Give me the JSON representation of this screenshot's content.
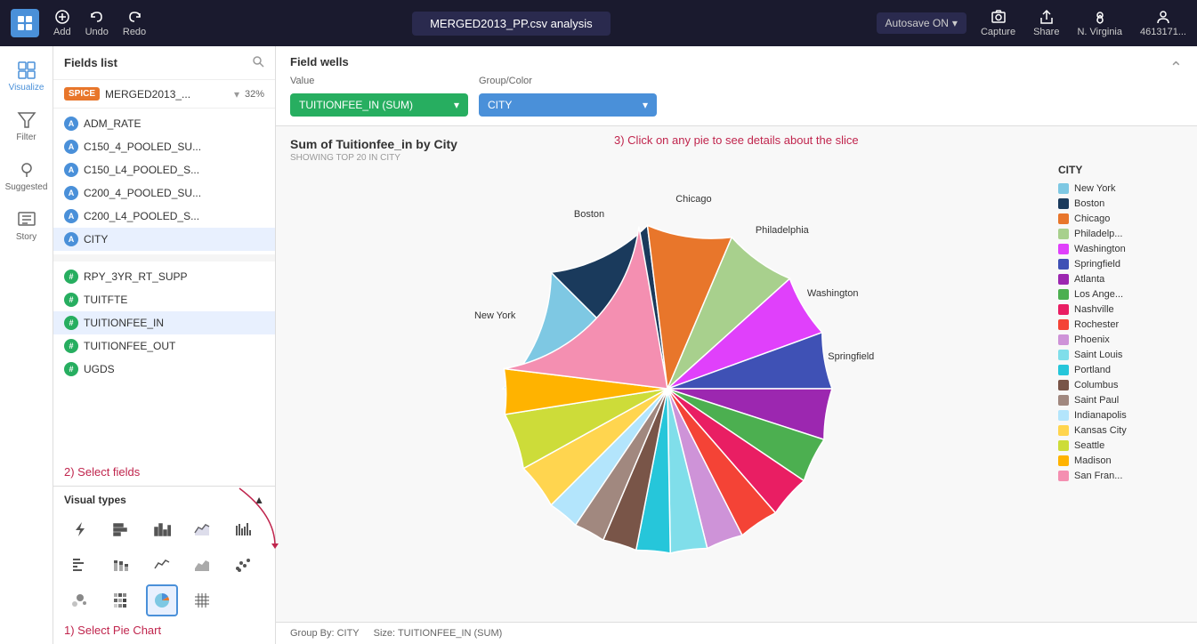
{
  "topbar": {
    "logo": "Q",
    "add_label": "Add",
    "undo_label": "Undo",
    "redo_label": "Redo",
    "title": "MERGED2013_PP.csv analysis",
    "autosave": "Autosave ON",
    "capture_label": "Capture",
    "share_label": "Share",
    "region_label": "N. Virginia",
    "user_label": "4613171..."
  },
  "sidebar": {
    "items": [
      {
        "id": "visualize",
        "label": "Visualize",
        "active": true
      },
      {
        "id": "filter",
        "label": "Filter",
        "active": false
      },
      {
        "id": "suggested",
        "label": "Suggested",
        "active": false
      },
      {
        "id": "story",
        "label": "Story",
        "active": false
      }
    ]
  },
  "fields_panel": {
    "title": "Fields list",
    "dataset_badge": "SPICE",
    "dataset_name": "MERGED2013_...",
    "dataset_percent": "32%",
    "fields": [
      {
        "id": "ADM_RATE",
        "type": "blue",
        "label": "ADM_RATE"
      },
      {
        "id": "C150_4_POOLED_SU",
        "type": "blue",
        "label": "C150_4_POOLED_SU..."
      },
      {
        "id": "C150_L4_POOLED_S",
        "type": "blue",
        "label": "C150_L4_POOLED_S..."
      },
      {
        "id": "C200_4_POOLED_SU",
        "type": "blue",
        "label": "C200_4_POOLED_SU..."
      },
      {
        "id": "C200_L4_POOLED_S",
        "type": "blue",
        "label": "C200_L4_POOLED_S..."
      },
      {
        "id": "CITY",
        "type": "blue",
        "label": "CITY",
        "active": true
      },
      {
        "id": "RPY_3YR_RT_SUPP",
        "type": "hash",
        "label": "RPY_3YR_RT_SUPP"
      },
      {
        "id": "TUITFTE",
        "type": "hash",
        "label": "TUITFTE"
      },
      {
        "id": "TUITIONFEE_IN",
        "type": "hash",
        "label": "TUITIONFEE_IN",
        "active": true
      },
      {
        "id": "TUITIONFEE_OUT",
        "type": "hash",
        "label": "TUITIONFEE_OUT"
      },
      {
        "id": "UGDS",
        "type": "hash",
        "label": "UGDS"
      }
    ]
  },
  "visual_types": {
    "title": "Visual types",
    "items": [
      "flash",
      "bar-h",
      "bar-v",
      "line-area",
      "bar-v2",
      "bar-h2",
      "bar-v3",
      "line",
      "area",
      "scatter",
      "scatter2",
      "heatmap",
      "pie",
      "grid"
    ],
    "active_index": 12
  },
  "field_wells": {
    "title": "Field wells",
    "value_label": "Value",
    "value_field": "TUITIONFEE_IN (SUM)",
    "group_label": "Group/Color",
    "group_field": "CITY"
  },
  "chart": {
    "title": "Sum of Tuitionfee_in by City",
    "subtitle": "SHOWING TOP 20 IN CITY",
    "footer_group": "Group By: CITY",
    "footer_size": "Size: TUITIONFEE_IN (SUM)"
  },
  "annotations": {
    "step1": "1) Select Pie Chart",
    "step2": "2) Select fields",
    "step3": "3) Click on any pie to see details about the slice"
  },
  "legend": {
    "title": "CITY",
    "items": [
      {
        "label": "New York",
        "color": "#7ec8e3"
      },
      {
        "label": "Boston",
        "color": "#1a3a5c"
      },
      {
        "label": "Chicago",
        "color": "#e8762b"
      },
      {
        "label": "Philadelp...",
        "color": "#a8d08d"
      },
      {
        "label": "Washington",
        "color": "#e040fb"
      },
      {
        "label": "Springfield",
        "color": "#3f51b5"
      },
      {
        "label": "Atlanta",
        "color": "#9c27b0"
      },
      {
        "label": "Los Ange...",
        "color": "#4caf50"
      },
      {
        "label": "Nashville",
        "color": "#e91e63"
      },
      {
        "label": "Rochester",
        "color": "#f44336"
      },
      {
        "label": "Phoenix",
        "color": "#ce93d8"
      },
      {
        "label": "Saint Louis",
        "color": "#80deea"
      },
      {
        "label": "Portland",
        "color": "#26c6da"
      },
      {
        "label": "Columbus",
        "color": "#795548"
      },
      {
        "label": "Saint Paul",
        "color": "#a1887f"
      },
      {
        "label": "Indianapolis",
        "color": "#b3e5fc"
      },
      {
        "label": "Kansas City",
        "color": "#ffd54f"
      },
      {
        "label": "Seattle",
        "color": "#cddc39"
      },
      {
        "label": "Madison",
        "color": "#ffb300"
      },
      {
        "label": "San Fran...",
        "color": "#f48fb1"
      }
    ]
  },
  "pie_slices": [
    {
      "label": "New York",
      "color": "#7ec8e3",
      "startAngle": -90,
      "sweep": 45
    },
    {
      "label": "Boston",
      "color": "#1a3a5c",
      "startAngle": -45,
      "sweep": 38
    },
    {
      "label": "Chicago",
      "color": "#e8762b",
      "startAngle": -7,
      "sweep": 30
    },
    {
      "label": "Philadelphia",
      "color": "#a8d08d",
      "startAngle": 23,
      "sweep": 25
    },
    {
      "label": "Washington",
      "color": "#e040fb",
      "startAngle": 48,
      "sweep": 22
    },
    {
      "label": "Springfield",
      "color": "#3f51b5",
      "startAngle": 70,
      "sweep": 20
    },
    {
      "label": "Atlanta",
      "color": "#9c27b0",
      "startAngle": 90,
      "sweep": 18
    },
    {
      "label": "Los Angeles",
      "color": "#4caf50",
      "startAngle": 108,
      "sweep": 16
    },
    {
      "label": "Nashville",
      "color": "#e91e63",
      "startAngle": 124,
      "sweep": 15
    },
    {
      "label": "Rochester",
      "color": "#f44336",
      "startAngle": 139,
      "sweep": 14
    },
    {
      "label": "Phoenix",
      "color": "#ce93d8",
      "startAngle": 153,
      "sweep": 13
    },
    {
      "label": "Saint Louis",
      "color": "#80deea",
      "startAngle": 166,
      "sweep": 13
    },
    {
      "label": "Portland",
      "color": "#26c6da",
      "startAngle": 179,
      "sweep": 12
    },
    {
      "label": "Columbus",
      "color": "#795548",
      "startAngle": 191,
      "sweep": 12
    },
    {
      "label": "Saint Paul",
      "color": "#a1887f",
      "startAngle": 203,
      "sweep": 11
    },
    {
      "label": "Indianapolis",
      "color": "#b3e5fc",
      "startAngle": 214,
      "sweep": 11
    },
    {
      "label": "Kansas City",
      "color": "#ffd54f",
      "startAngle": 225,
      "sweep": 16
    },
    {
      "label": "Seattle",
      "color": "#cddc39",
      "startAngle": 241,
      "sweep": 20
    },
    {
      "label": "Madison",
      "color": "#ffb300",
      "startAngle": 261,
      "sweep": 16
    },
    {
      "label": "San Francisco",
      "color": "#f48fb1",
      "startAngle": 277,
      "sweep": 73
    }
  ],
  "pie_labels": [
    {
      "label": "New York",
      "angle": -67,
      "r": 200
    },
    {
      "label": "Boston",
      "angle": -26,
      "r": 200
    },
    {
      "label": "Chicago",
      "angle": 8,
      "r": 200
    },
    {
      "label": "Philadelphia",
      "angle": 36,
      "r": 210
    },
    {
      "label": "Washington",
      "angle": 59,
      "r": 200
    },
    {
      "label": "Springfield",
      "angle": 80,
      "r": 200
    }
  ]
}
